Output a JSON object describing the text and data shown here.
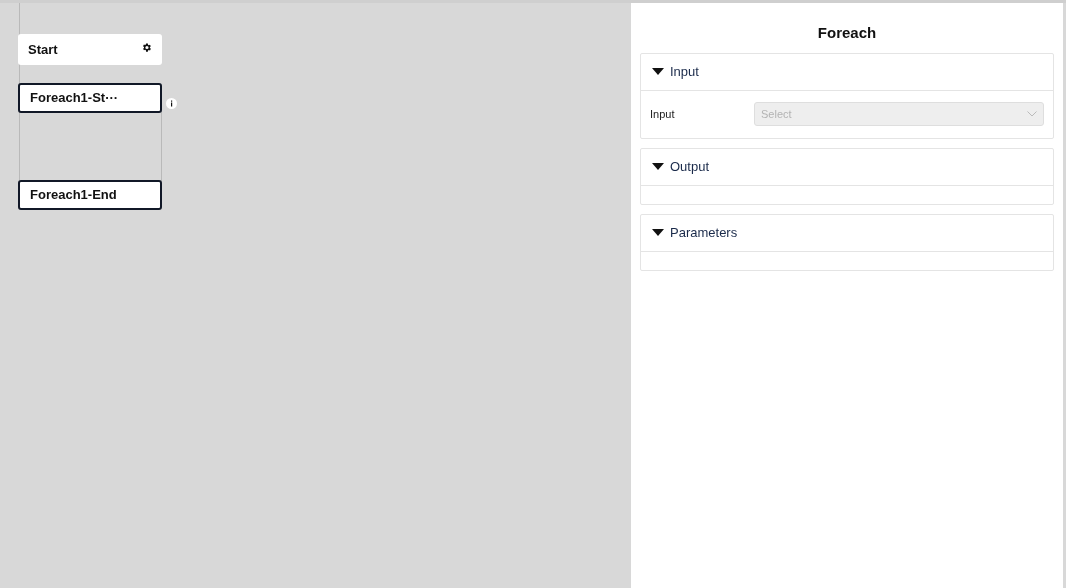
{
  "canvas": {
    "nodes": [
      {
        "kind": "start",
        "label": "Start",
        "selected": false
      },
      {
        "kind": "loop-start",
        "label": "Foreach1-St···",
        "selected": true
      },
      {
        "kind": "loop-end",
        "label": "Foreach1-End",
        "selected": true
      }
    ]
  },
  "panel": {
    "title": "Foreach",
    "sections": [
      {
        "title": "Input",
        "expanded": true,
        "fields": [
          {
            "label": "Input",
            "placeholder": "Select",
            "disabled": true
          }
        ]
      },
      {
        "title": "Output",
        "expanded": true
      },
      {
        "title": "Parameters",
        "expanded": true
      }
    ]
  }
}
